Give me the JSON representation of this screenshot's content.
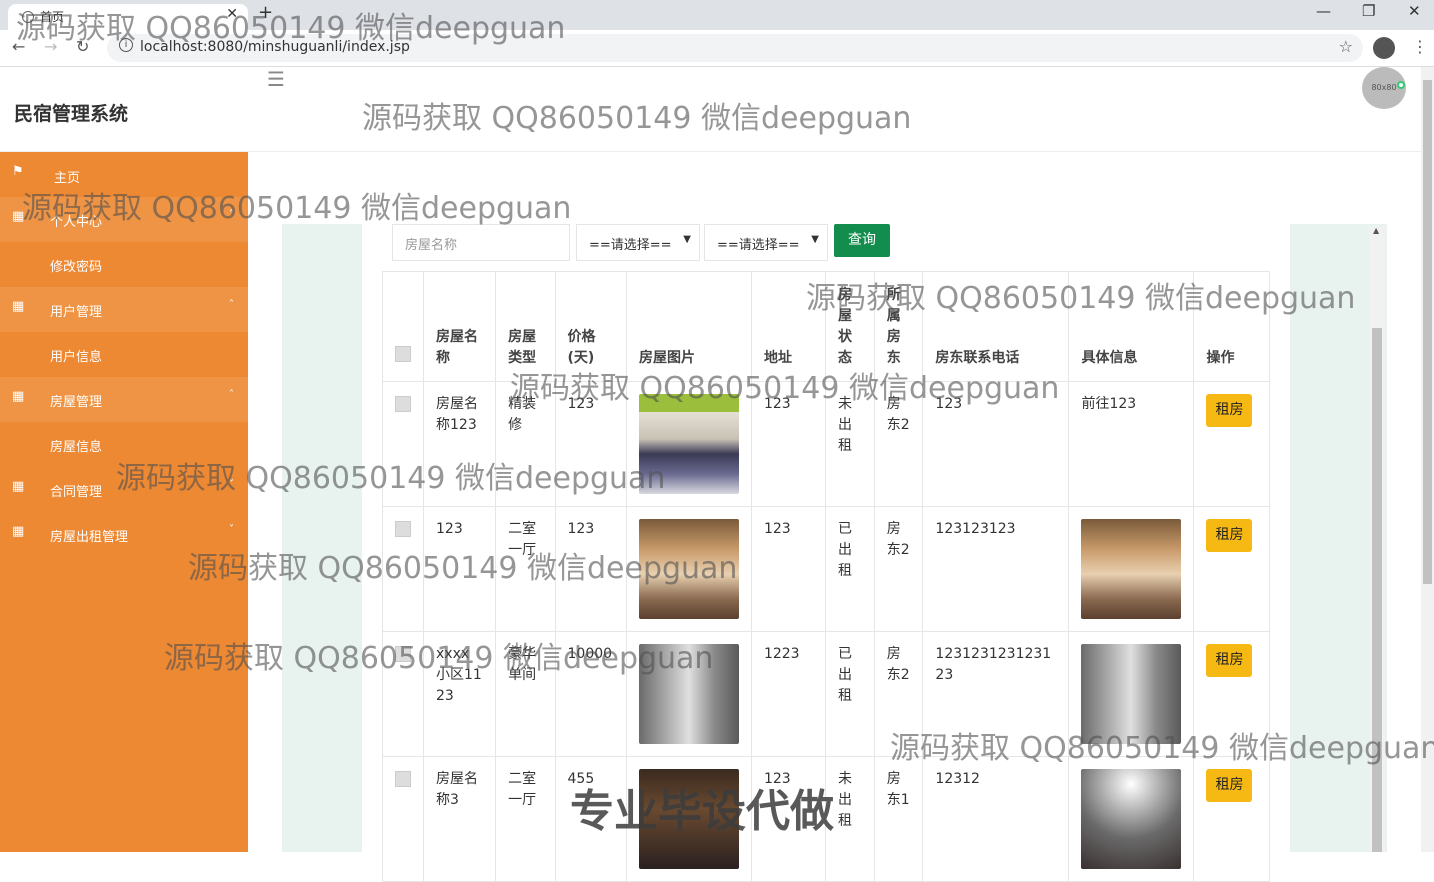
{
  "browser": {
    "tab_title": "首页",
    "tab_close": "✕",
    "new_tab": "+",
    "url": "localhost:8080/minshuguanli/index.jsp",
    "minimize": "—",
    "restore": "❐",
    "close": "✕"
  },
  "header": {
    "title": "民宿管理系统",
    "avatar_text": "80x80"
  },
  "sidebar": {
    "items": [
      {
        "label": "主页",
        "icon": "flag-icon"
      },
      {
        "label": "个人中心",
        "icon": "grid-icon"
      },
      {
        "label": "修改密码"
      },
      {
        "label": "用户管理",
        "icon": "grid-icon"
      },
      {
        "label": "用户信息"
      },
      {
        "label": "房屋管理",
        "icon": "grid-icon"
      },
      {
        "label": "房屋信息"
      },
      {
        "label": "合同管理",
        "icon": "grid-icon"
      },
      {
        "label": "房屋出租管理",
        "icon": "grid-icon"
      }
    ]
  },
  "search": {
    "placeholder": "房屋名称",
    "select1": "==请选择==",
    "select2": "==请选择==",
    "button": "查询"
  },
  "table": {
    "headers": [
      "房屋名称",
      "房屋类型",
      "价格(天)",
      "房屋图片",
      "地址",
      "房屋状态",
      "所属房东",
      "房东联系电话",
      "具体信息",
      "操作"
    ],
    "rows": [
      {
        "name": "房屋名称123",
        "type": "精装修",
        "price": "123",
        "addr": "123",
        "status": "未出租",
        "owner": "房东2",
        "phone": "123",
        "info": "前往123",
        "action": "租房"
      },
      {
        "name": "123",
        "type": "二室一厅",
        "price": "123",
        "addr": "123",
        "status": "已出租",
        "owner": "房东2",
        "phone": "123123123",
        "info": "",
        "action": "租房"
      },
      {
        "name": "xxxx小区1123",
        "type": "豪华单间",
        "price": "10000",
        "addr": "1223",
        "status": "已出租",
        "owner": "房东2",
        "phone": "123123123123123",
        "info": "",
        "action": "租房"
      },
      {
        "name": "房屋名称3",
        "type": "二室一厅",
        "price": "455",
        "addr": "123",
        "status": "未出租",
        "owner": "房东1",
        "phone": "12312",
        "info": "",
        "action": "租房"
      }
    ]
  },
  "watermark": {
    "text": "源码获取 QQ86050149 微信deepguan",
    "big": "专业毕设代做"
  }
}
